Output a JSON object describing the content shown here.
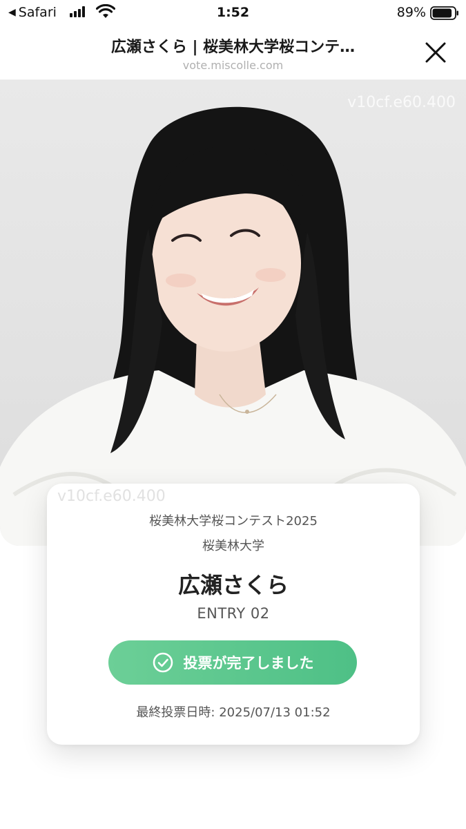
{
  "status_bar": {
    "back_app": "Safari",
    "time": "1:52",
    "battery_percent": "89%",
    "battery_level": 0.89
  },
  "browser": {
    "title": "広瀬さくら | 桜美林大学桜コンテ…",
    "url": "vote.miscolle.com"
  },
  "photo": {
    "watermark": "v10cf.e60.400"
  },
  "card": {
    "watermark": "v10cf.e60.400",
    "contest": "桜美林大学桜コンテスト2025",
    "university": "桜美林大学",
    "name": "広瀬さくら",
    "entry": "ENTRY 02",
    "vote_button": "投票が完了しました",
    "last_vote": "最終投票日時: 2025/07/13 01:52"
  },
  "colors": {
    "accent_green": "#55c38a",
    "text_muted": "#555555",
    "url_gray": "#b0b0b0"
  },
  "icons": [
    "back-arrow-icon",
    "cellular-signal-icon",
    "wifi-icon",
    "battery-icon",
    "close-icon",
    "check-circle-icon"
  ]
}
